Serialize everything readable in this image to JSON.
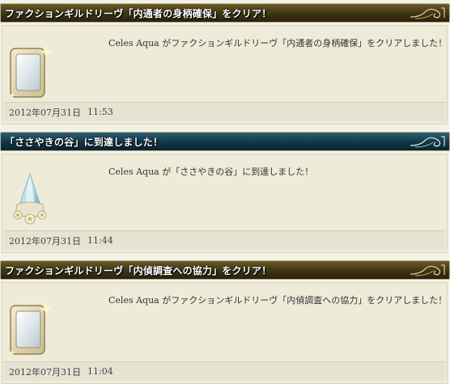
{
  "entries": [
    {
      "style": "gold",
      "icon": "mirror-card-icon",
      "title": "ファクションギルドリーヴ「内通者の身柄確保」をクリア！",
      "message": "Celes Aqua がファクションギルドリーヴ「内通者の身柄確保」をクリアしました！",
      "date": "2012年07月31日",
      "time": "11:53"
    },
    {
      "style": "blue",
      "icon": "crystal-landmark-icon",
      "title": "「ささやきの谷」に到達しました！",
      "message": "Celes Aqua が「ささやきの谷」に到達しました！",
      "date": "2012年07月31日",
      "time": "11:44"
    },
    {
      "style": "gold",
      "icon": "mirror-card-icon",
      "title": "ファクションギルドリーヴ「内偵調査への協力」をクリア！",
      "message": "Celes Aqua がファクションギルドリーヴ「内偵調査への協力」をクリアしました！",
      "date": "2012年07月31日",
      "time": "11:04"
    }
  ],
  "colors": {
    "gold_header": "#3d3314",
    "blue_header": "#123646",
    "panel_bg": "#eeebd9"
  }
}
